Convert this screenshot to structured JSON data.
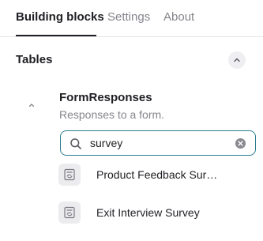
{
  "tabs": [
    {
      "label": "Building blocks",
      "active": true
    },
    {
      "label": "Settings",
      "active": false
    },
    {
      "label": "About",
      "active": false
    }
  ],
  "section": {
    "title": "Tables",
    "collapse_icon": "chevron-up-icon"
  },
  "table": {
    "name": "FormResponses",
    "description": "Responses to a form.",
    "expand_icon": "chevron-up-icon"
  },
  "search": {
    "value": "survey",
    "icon": "search-icon",
    "clear_icon": "clear-icon"
  },
  "results": [
    {
      "label": "Product Feedback Survey",
      "icon": "form-icon"
    },
    {
      "label": "Exit Interview Survey",
      "icon": "form-icon"
    }
  ],
  "colors": {
    "accent": "#2a7e8e",
    "text": "#1f1f24",
    "muted": "#85858c"
  }
}
